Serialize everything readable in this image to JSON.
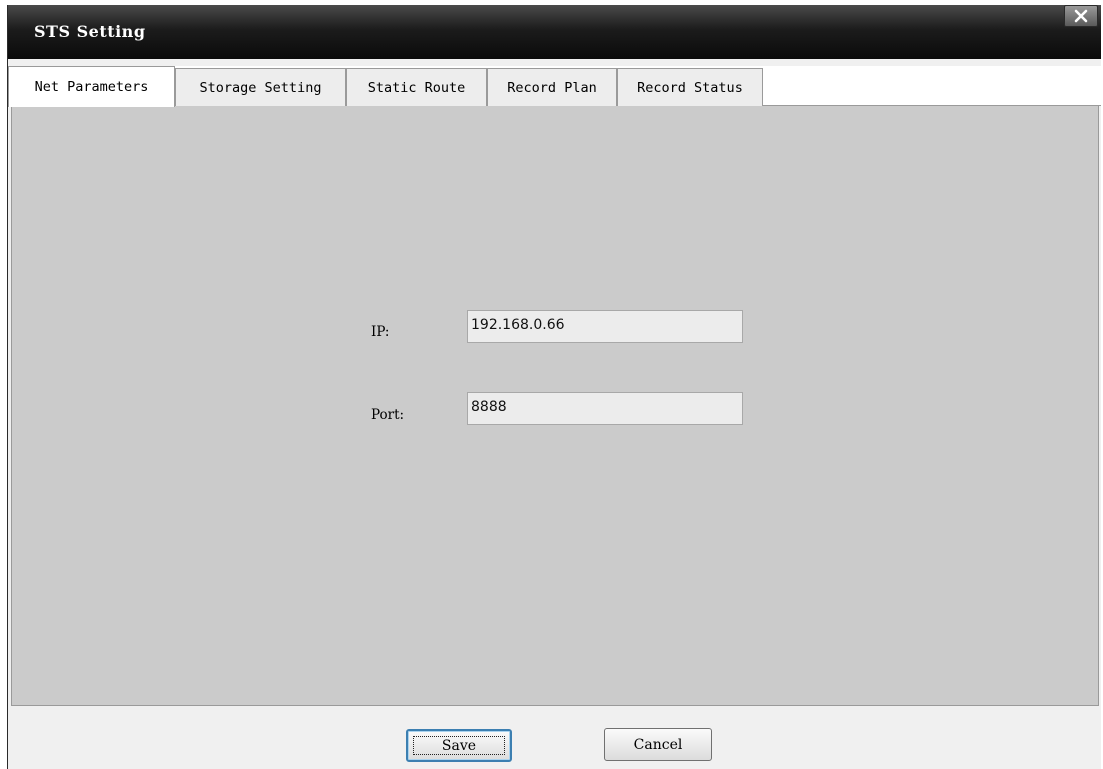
{
  "window": {
    "title": "STS Setting"
  },
  "tabs": [
    {
      "label": "Net Parameters",
      "active": true
    },
    {
      "label": "Storage Setting",
      "active": false
    },
    {
      "label": "Static Route",
      "active": false
    },
    {
      "label": "Record Plan",
      "active": false
    },
    {
      "label": "Record Status",
      "active": false
    }
  ],
  "form": {
    "ip_label": "IP:",
    "ip_value": "192.168.0.66",
    "port_label": "Port:",
    "port_value": "8888"
  },
  "buttons": {
    "save": "Save",
    "cancel": "Cancel"
  },
  "icons": {
    "close": "close-icon"
  }
}
